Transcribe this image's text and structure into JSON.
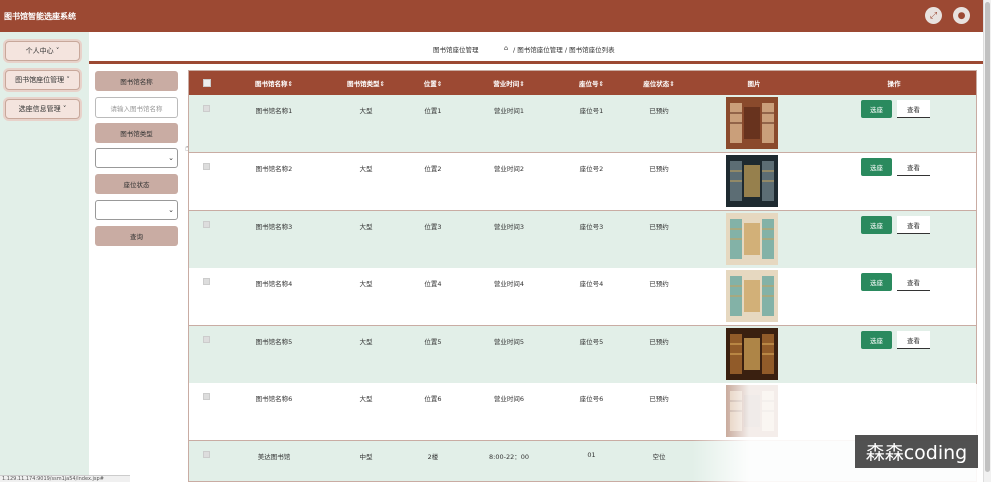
{
  "app": {
    "title": "图书馆智能选座系统"
  },
  "header": {
    "icons": [
      "fullscreen-icon",
      "user-icon"
    ]
  },
  "sidebar": {
    "items": [
      {
        "label": "个人中心 ˅"
      },
      {
        "label": "图书馆座位管理 ˅"
      },
      {
        "label": "选座信息管理 ˅"
      }
    ]
  },
  "breadcrumb": {
    "left": "图书馆座位管理",
    "path": "/ 图书馆座位管理 / 图书馆座位列表"
  },
  "filter": {
    "name_label": "图书馆名称",
    "name_placeholder": "请输入图书馆名称",
    "type_label": "图书馆类型",
    "type_value": "",
    "status_label": "座位状态",
    "status_value": "",
    "search_label": "查询"
  },
  "table": {
    "headers": [
      "图书馆名称⇕",
      "图书馆类型⇕",
      "位置⇕",
      "营业时间⇕",
      "座位号⇕",
      "座位状态⇕",
      "图片",
      "操作"
    ],
    "rows": [
      {
        "name": "图书馆名称1",
        "type": "大型",
        "loc": "位置1",
        "hours": "营业时间1",
        "seat": "座位号1",
        "status": "已预约",
        "img": "library-hall-image",
        "select": "选座",
        "view": "查看"
      },
      {
        "name": "图书馆名称2",
        "type": "大型",
        "loc": "位置2",
        "hours": "营业时间2",
        "seat": "座位号2",
        "status": "已预约",
        "img": "library-dark-image",
        "select": "选座",
        "view": "查看"
      },
      {
        "name": "图书馆名称3",
        "type": "大型",
        "loc": "位置3",
        "hours": "营业时间3",
        "seat": "座位号3",
        "status": "已预约",
        "img": "library-cafe-image",
        "select": "选座",
        "view": "查看"
      },
      {
        "name": "图书馆名称4",
        "type": "大型",
        "loc": "位置4",
        "hours": "营业时间4",
        "seat": "座位号4",
        "status": "已预约",
        "img": "library-cafe-image",
        "select": "选座",
        "view": "查看"
      },
      {
        "name": "图书馆名称5",
        "type": "大型",
        "loc": "位置5",
        "hours": "营业时间5",
        "seat": "座位号5",
        "status": "已预约",
        "img": "library-warm-image",
        "select": "选座",
        "view": "查看"
      },
      {
        "name": "图书馆名称6",
        "type": "大型",
        "loc": "位置6",
        "hours": "营业时间6",
        "seat": "座位号6",
        "status": "已预约",
        "img": "library-hall-image",
        "select": "",
        "view": ""
      },
      {
        "name": "美达图书馆",
        "type": "中型",
        "loc": "2楼",
        "hours": "8:00-22：00",
        "seat": "01",
        "status": "空位",
        "img": "",
        "select": "",
        "view": ""
      }
    ]
  },
  "statusbar": {
    "url": "1.129.11.174:9019/ssm1ja54/index.jsp#"
  },
  "watermark": {
    "text": "森森coding"
  }
}
